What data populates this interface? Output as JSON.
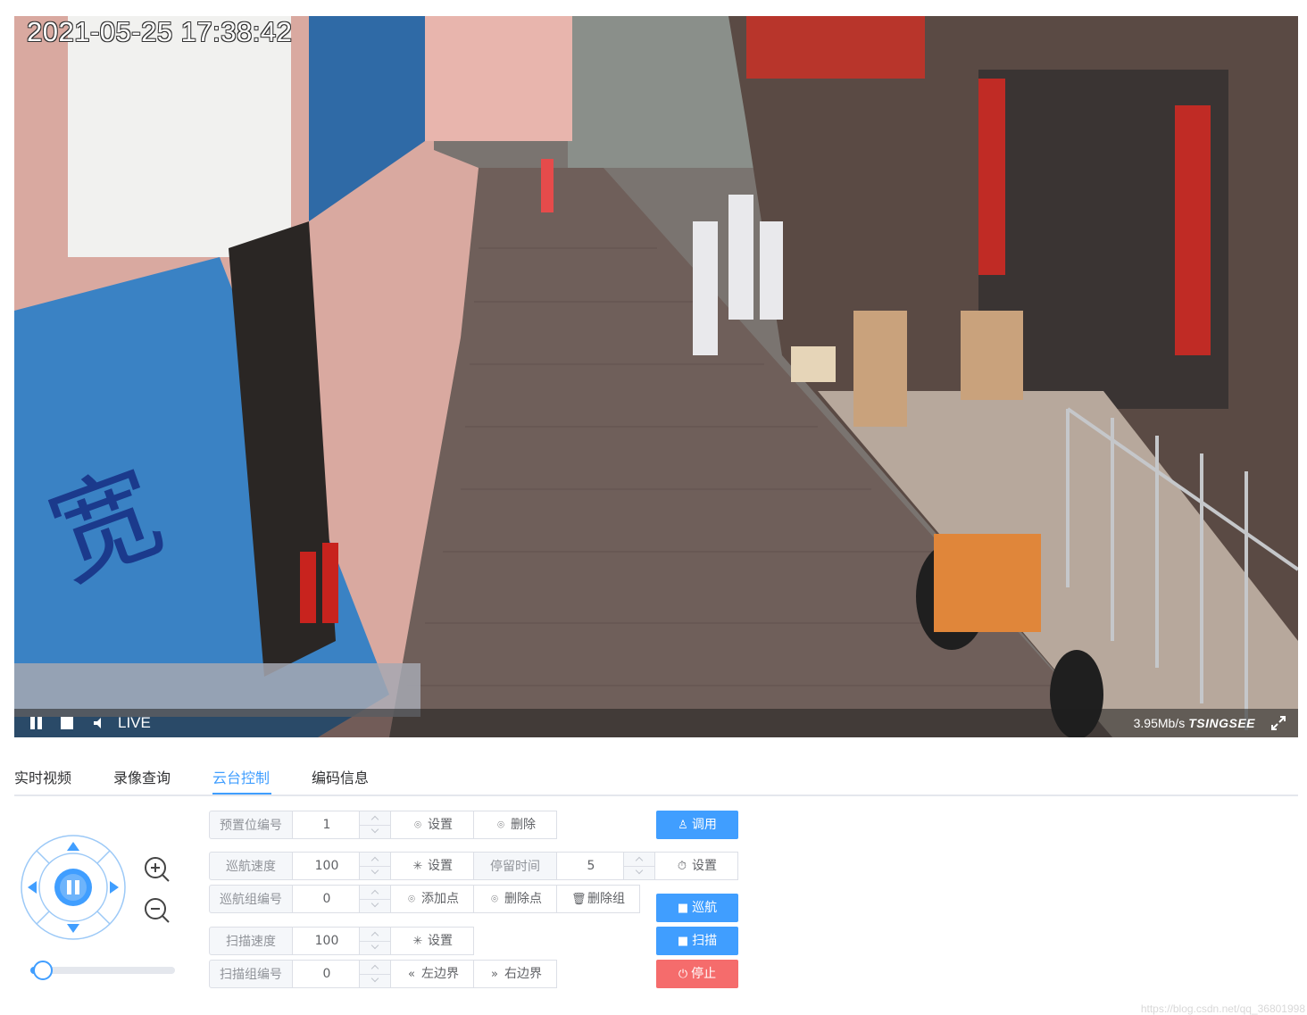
{
  "video": {
    "timestamp": "2021-05-25 17:38:42",
    "live_label": "LIVE",
    "bitrate": "3.95Mb/s",
    "brand": "TSINGSEE",
    "icons": [
      "pause-icon",
      "stop-icon",
      "volume-icon",
      "fullscreen-icon"
    ]
  },
  "tabs": [
    "实时视频",
    "录像查询",
    "云台控制",
    "编码信息"
  ],
  "active_tab": "云台控制",
  "ptz": {
    "speed_slider_value": 0.05
  },
  "form": {
    "preset": {
      "label": "预置位编号",
      "value": "1",
      "set": "设置",
      "delete": "删除"
    },
    "cruise_speed": {
      "label": "巡航速度",
      "value": "100",
      "set": "设置"
    },
    "dwell_time": {
      "label": "停留时间",
      "value": "5",
      "set": "设置"
    },
    "cruise_group": {
      "label": "巡航组编号",
      "value": "0",
      "add_point": "添加点",
      "delete_point": "删除点",
      "delete_group": "删除组"
    },
    "scan_speed": {
      "label": "扫描速度",
      "value": "100",
      "set": "设置"
    },
    "scan_group": {
      "label": "扫描组编号",
      "value": "0",
      "left_border": "左边界",
      "right_border": "右边界"
    }
  },
  "actions": {
    "call": "调用",
    "cruise": "巡航",
    "scan": "扫描",
    "stop": "停止"
  },
  "colors": {
    "primary": "#409eff",
    "danger": "#f56c6c",
    "tab_border": "#e4e7ed"
  },
  "watermark": "https://blog.csdn.net/qq_36801998"
}
